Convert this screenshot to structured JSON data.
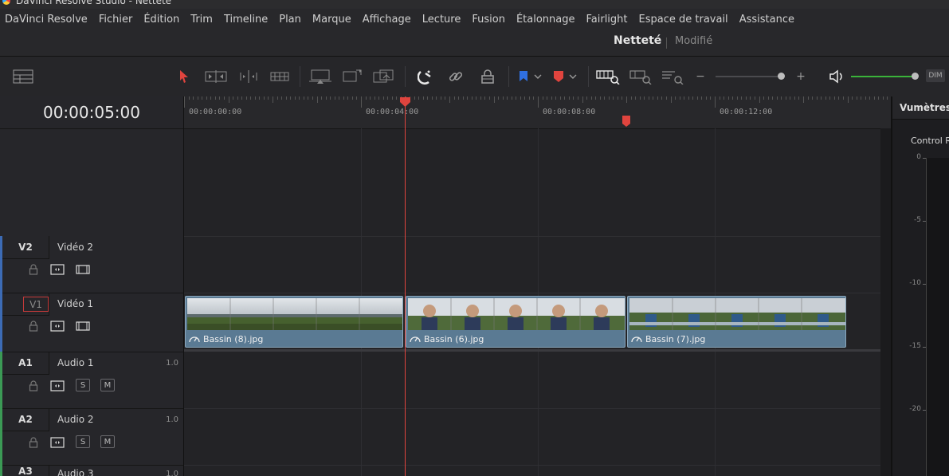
{
  "window": {
    "title": "DaVinci Resolve Studio - Netteté"
  },
  "menu": [
    "DaVinci Resolve",
    "Fichier",
    "Édition",
    "Trim",
    "Timeline",
    "Plan",
    "Marque",
    "Affichage",
    "Lecture",
    "Fusion",
    "Étalonnage",
    "Fairlight",
    "Espace de travail",
    "Assistance"
  ],
  "project": {
    "name": "Netteté",
    "status": "Modifié"
  },
  "toolbar": {
    "dim_label": "DIM",
    "zoom_minus": "−",
    "zoom_plus": "+"
  },
  "timecode": "00:00:05:00",
  "ruler": {
    "labels": [
      "00:00:00:00",
      "00:00:04:00",
      "00:00:08:00",
      "00:00:12:00"
    ]
  },
  "tracks": [
    {
      "id": "V2",
      "name": "Vidéo 2",
      "type": "video",
      "level": ""
    },
    {
      "id": "V1",
      "name": "Vidéo 1",
      "type": "video",
      "level": ""
    },
    {
      "id": "A1",
      "name": "Audio 1",
      "type": "audio",
      "level": "1.0",
      "solo": "S",
      "mute": "M"
    },
    {
      "id": "A2",
      "name": "Audio 2",
      "type": "audio",
      "level": "1.0",
      "solo": "S",
      "mute": "M"
    },
    {
      "id": "A3",
      "name": "Audio 3",
      "type": "audio",
      "level": "1.0"
    }
  ],
  "clips": [
    {
      "name": "Bassin (8).jpg",
      "start_tc": "00:00:00:00",
      "style": "field"
    },
    {
      "name": "Bassin (6).jpg",
      "start_tc": "00:00:05:00",
      "style": "person"
    },
    {
      "name": "Bassin (7).jpg",
      "start_tc": "00:00:10:00",
      "style": "heron"
    }
  ],
  "meters": {
    "title": "Vumètres",
    "subtitle": "Control R",
    "scale": [
      "0",
      "-5",
      "-10",
      "-15",
      "-20"
    ]
  },
  "colors": {
    "accent_red": "#e0443e",
    "clip_blue": "#5a7a93",
    "video_track": "#3c6bb5",
    "audio_track": "#3b9a55",
    "volume_green": "#3ab33a"
  }
}
